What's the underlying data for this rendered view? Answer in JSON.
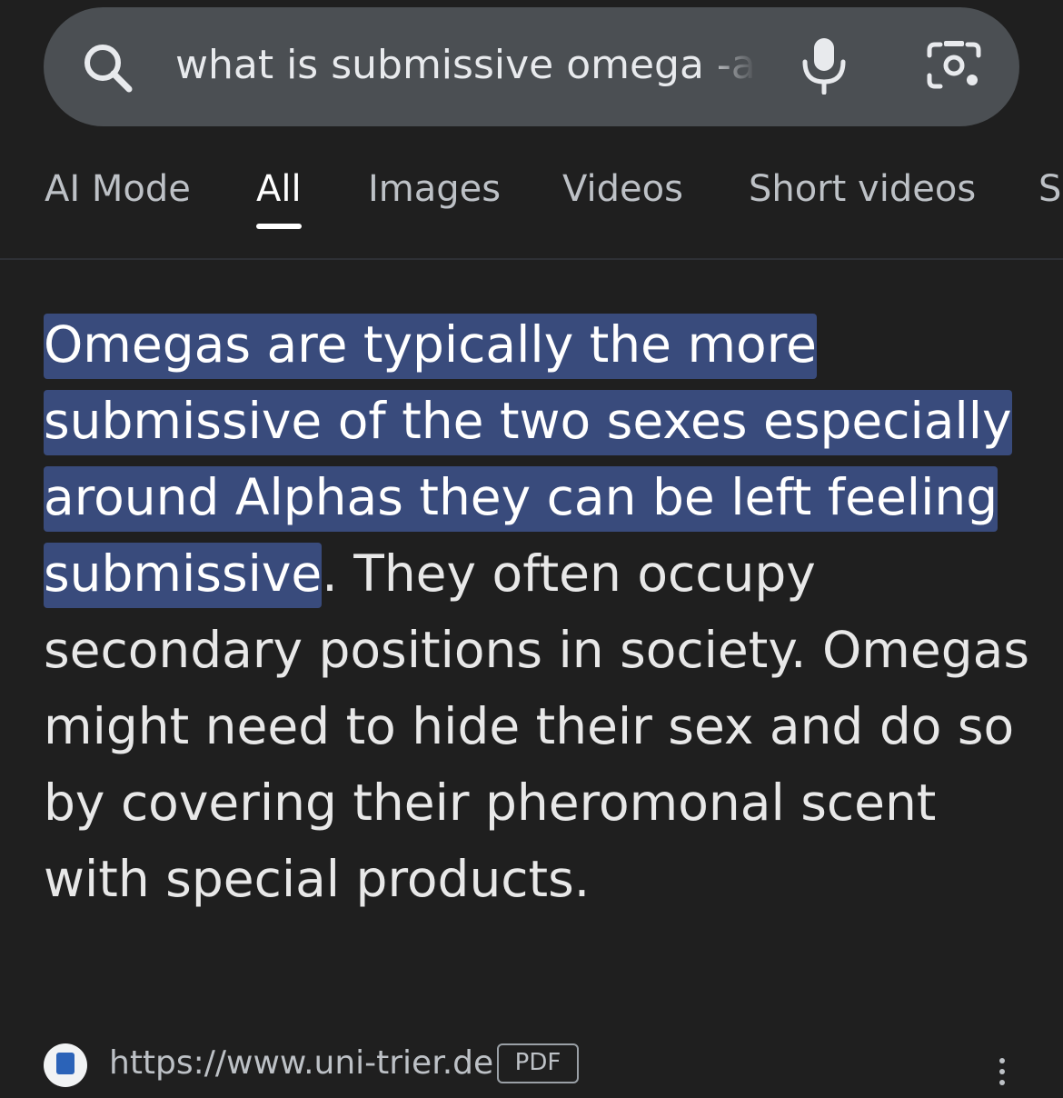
{
  "search": {
    "query": "what is submissive omega -ai",
    "icons": [
      "search-icon",
      "mic-icon",
      "lens-icon"
    ]
  },
  "tabs": [
    {
      "label": "AI Mode",
      "active": false
    },
    {
      "label": "All",
      "active": true
    },
    {
      "label": "Images",
      "active": false
    },
    {
      "label": "Videos",
      "active": false
    },
    {
      "label": "Short videos",
      "active": false
    },
    {
      "label": "S",
      "active": false
    }
  ],
  "answer": {
    "highlighted": "Omegas are typically the more submissive of the two sexes especially around Alphas they can be left feeling submissive",
    "rest": ". They often occupy secondary positions in society. Omegas might need to hide their sex and do so by covering their pheromonal scent with special products."
  },
  "source": {
    "url": "https://www.uni-trier.de",
    "badge": "PDF"
  },
  "colors": {
    "background": "#1f1f1f",
    "search_bar": "#4b4f53",
    "highlight": "#394b7c",
    "tab_inactive": "#bdc1c6",
    "tab_active": "#ffffff"
  }
}
